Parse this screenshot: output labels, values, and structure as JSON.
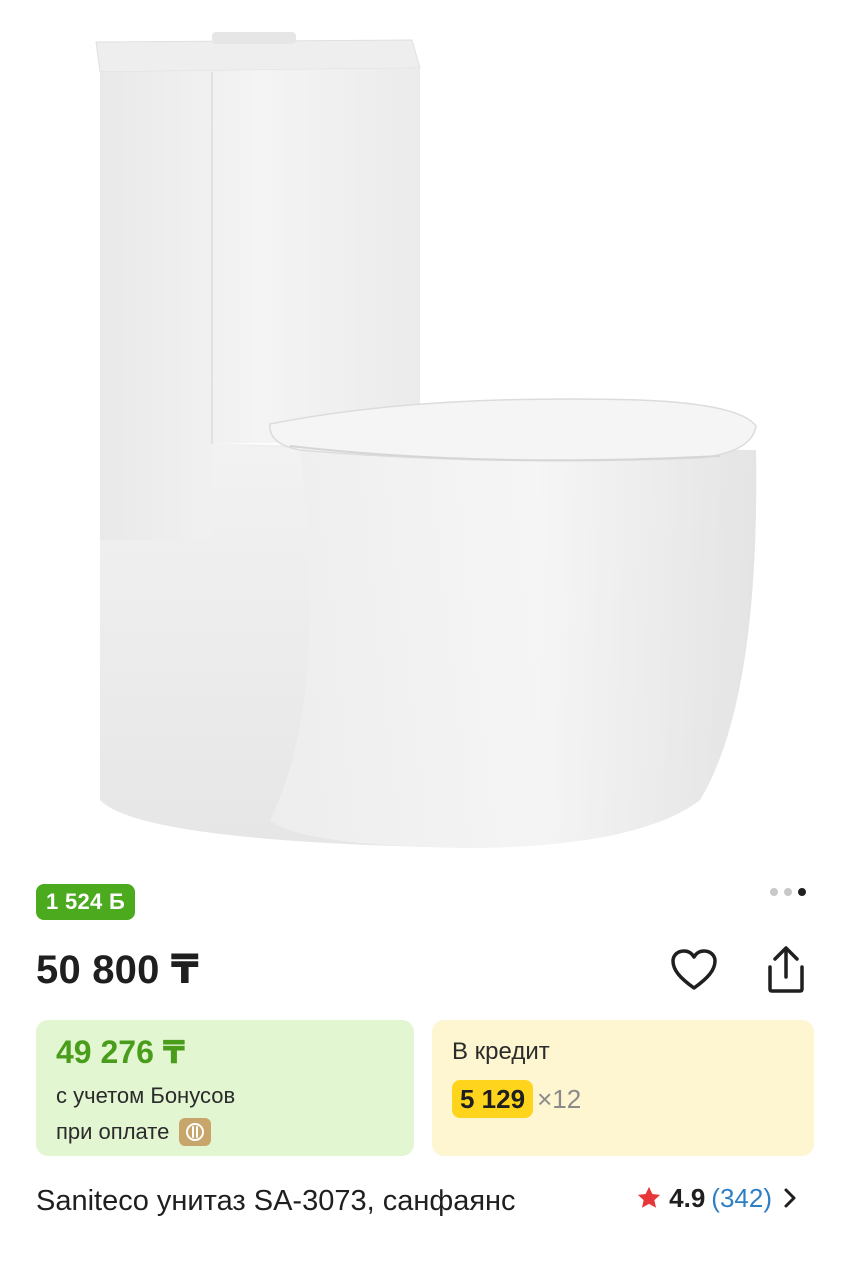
{
  "product": {
    "image_alt": "",
    "bonus_badge": "1 524 Б",
    "pager": {
      "total": 3,
      "active_index": 2
    },
    "price": "50 800 ₸",
    "bonus_offer": {
      "price": "49 276 ₸",
      "line1": "с учетом Бонусов",
      "line2": "при оплате"
    },
    "credit_offer": {
      "title": "В кредит",
      "monthly_amount": "5 129",
      "months_label": "×12"
    },
    "title": "Sanitecо унитаз SA-3073, санфаянс",
    "rating": {
      "value": "4.9",
      "reviews": "(342)"
    }
  },
  "colors": {
    "bonus_green": "#4caa1e",
    "bonus_card_bg": "#e3f6d2",
    "credit_card_bg": "#fdf6d1",
    "credit_highlight": "#ffd41c",
    "star_red": "#e8373a",
    "link_blue": "#2f7fc4"
  },
  "icons": {
    "favorite": "heart-outline-icon",
    "share": "share-icon",
    "payment": "payment-chip-icon",
    "rating_star": "star-icon",
    "chevron": "chevron-right-icon"
  }
}
